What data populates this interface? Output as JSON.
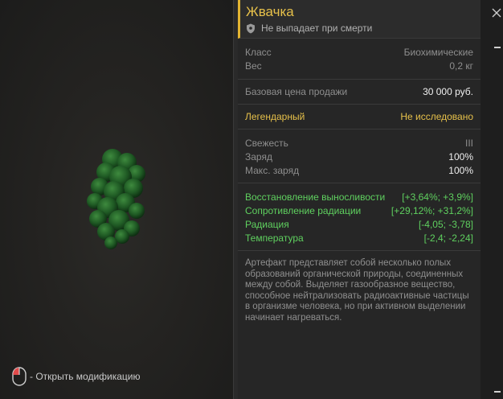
{
  "viewer": {
    "hint_label": "- Открыть модификацию"
  },
  "item": {
    "title": "Жвачка",
    "subtitle": "Не выпадает при смерти",
    "class_label": "Класс",
    "class_value": "Биохимические",
    "weight_label": "Вес",
    "weight_value": "0,2 кг",
    "price_label": "Базовая цена продажи",
    "price_value": "30 000 руб.",
    "rarity_label": "Легендарный",
    "rarity_value": "Не исследовано",
    "freshness_label": "Свежесть",
    "freshness_value": "III",
    "charge_label": "Заряд",
    "charge_value": "100%",
    "max_charge_label": "Макс. заряд",
    "max_charge_value": "100%",
    "stats": [
      {
        "label": "Восстановление выносливости",
        "value": "[+3,64%; +3,9%]"
      },
      {
        "label": "Сопротивление радиации",
        "value": "[+29,12%; +31,2%]"
      },
      {
        "label": "Радиация",
        "value": "[-4,05; -3,78]"
      },
      {
        "label": "Температура",
        "value": "[-2,4; -2,24]"
      }
    ],
    "description": "Артефакт представляет собой несколько полых образований органической природы, соединенных между собой. Выделяет газообразное вещество, способное нейтрализовать радиоактивные частицы в организме человека, но при активном выделении начинает нагреваться."
  },
  "colors": {
    "accent": "#e6c04a",
    "positive": "#5fd05f",
    "muted": "#8e8e8e"
  }
}
